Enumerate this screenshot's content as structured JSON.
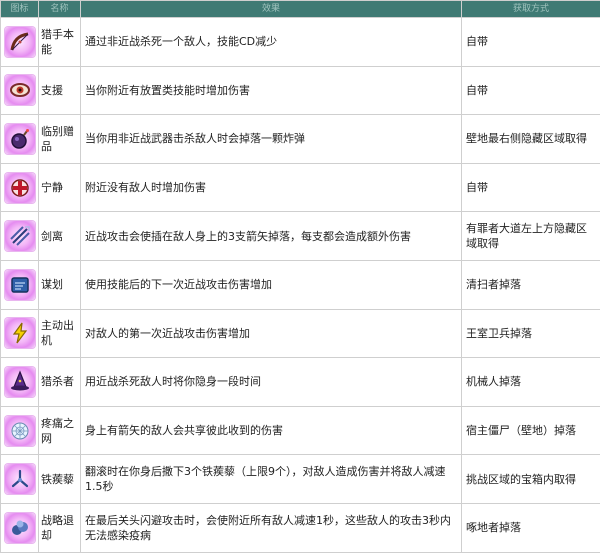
{
  "table": {
    "headers": [
      "图标",
      "名称",
      "效果",
      "获取方式"
    ],
    "rows": [
      {
        "icon": "bow-icon",
        "name": "猎手本能",
        "desc": "通过非近战杀死一个敌人，技能CD减少",
        "src": "自带"
      },
      {
        "icon": "eye-icon",
        "name": "支援",
        "desc": "当你附近有放置类技能时增加伤害",
        "src": "自带"
      },
      {
        "icon": "bomb-icon",
        "name": "临别赠品",
        "desc": "当你用非近战武器击杀敌人时会掉落一颗炸弹",
        "src": "壁地最右侧隐藏区域取得"
      },
      {
        "icon": "cross-icon",
        "name": "宁静",
        "desc": "附近没有敌人时增加伤害",
        "src": "自带"
      },
      {
        "icon": "arrows-icon",
        "name": "剑离",
        "desc": "近战攻击会使插在敌人身上的3支箭矢掉落，每支都会造成额外伤害",
        "src": "有罪者大道左上方隐藏区域取得"
      },
      {
        "icon": "scroll-icon",
        "name": "谋划",
        "desc": "使用技能后的下一次近战攻击伤害增加",
        "src": "清扫者掉落"
      },
      {
        "icon": "lightning-icon",
        "name": "主动出机",
        "desc": "对敌人的第一次近战攻击伤害增加",
        "src": "王室卫兵掉落"
      },
      {
        "icon": "wizard-hat-icon",
        "name": "猎杀者",
        "desc": "用近战杀死敌人时将你隐身一段时间",
        "src": "机械人掉落"
      },
      {
        "icon": "web-icon",
        "name": "疼痛之网",
        "desc": "身上有箭矢的敌人会共享彼此收到的伤害",
        "src": "宿主僵尸（壁地）掉落"
      },
      {
        "icon": "caltrops-icon",
        "name": "铁蒺藜",
        "desc": "翻滚时在你身后撒下3个铁蒺藜（上限9个），对敌人造成伤害并将敌人减速1.5秒",
        "src": "挑战区域的宝箱内取得"
      },
      {
        "icon": "smoke-icon",
        "name": "战略退却",
        "desc": "在最后关头闪避攻击时，会使附近所有敌人减速1秒，这些敌人的攻击3秒内无法感染疫病",
        "src": "啄地者掉落"
      }
    ]
  }
}
